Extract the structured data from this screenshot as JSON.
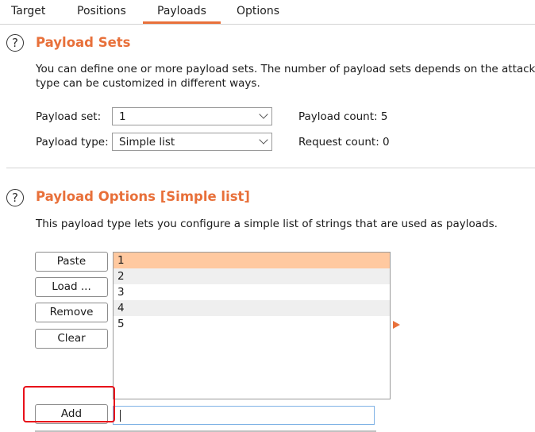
{
  "tabs": [
    "Target",
    "Positions",
    "Payloads",
    "Options"
  ],
  "active_tab": "Payloads",
  "accent_color": "#e8703a",
  "payload_sets": {
    "title": "Payload Sets",
    "description_line1": "You can define one or more payload sets. The number of payload sets depends on the attack",
    "description_line2": "type can be customized in different ways.",
    "set_label": "Payload set:",
    "set_value": "1",
    "type_label": "Payload type:",
    "type_value": "Simple list",
    "payload_count": "Payload count: 5",
    "request_count": "Request count: 0"
  },
  "payload_options": {
    "title": "Payload Options [Simple list]",
    "description": "This payload type lets you configure a simple list of strings that are used as payloads.",
    "buttons": {
      "paste": "Paste",
      "load": "Load ...",
      "remove": "Remove",
      "clear": "Clear",
      "add": "Add"
    },
    "items": [
      "1",
      "2",
      "3",
      "4",
      "5"
    ],
    "selected_item": "1",
    "add_input_value": ""
  }
}
